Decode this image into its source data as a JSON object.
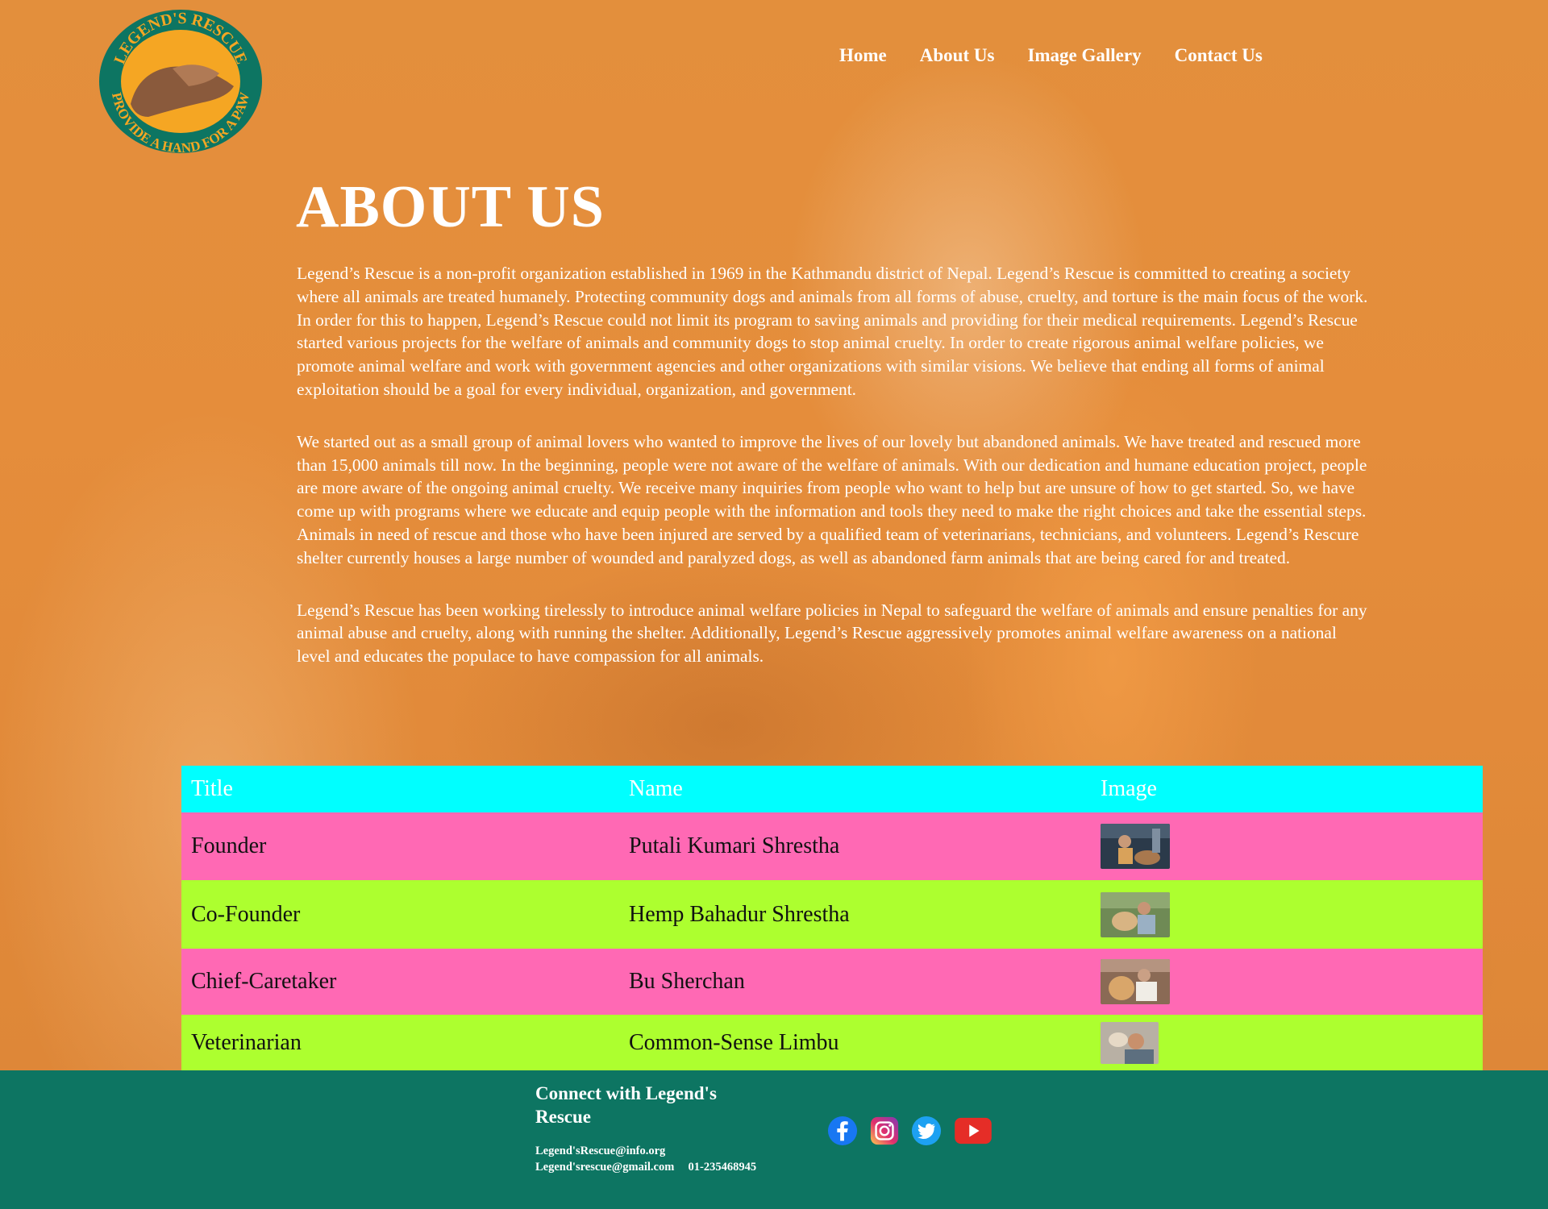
{
  "logo": {
    "top_text": "LEGEND'S RESCUE",
    "bottom_text": "PROVIDE A HAND FOR A PAW",
    "colors": {
      "ring": "#0d7562",
      "inner": "#f5a623",
      "text": "#f5a623"
    }
  },
  "nav": {
    "items": [
      {
        "label": "Home"
      },
      {
        "label": "About Us"
      },
      {
        "label": "Image Gallery"
      },
      {
        "label": "Contact Us"
      }
    ]
  },
  "page_title": "ABOUT US",
  "about_paragraphs": [
    "Legend’s Rescue is a non-profit organization established in 1969 in the Kathmandu district of Nepal. Legend’s Rescue is committed to creating a society where all animals are treated humanely. Protecting community dogs and animals from all forms of abuse, cruelty, and torture is the main focus of the work. In order for this to happen, Legend’s Rescue could not limit its program to saving animals and providing for their medical requirements. Legend’s Rescue started various projects for the welfare of animals and community dogs to stop animal cruelty. In order to create rigorous animal welfare policies, we promote animal welfare and work with government agencies and other organizations with similar visions. We believe that ending all forms of animal exploitation should be a goal for every individual, organization, and government.",
    "We started out as a small group of animal lovers who wanted to improve the lives of our lovely but abandoned animals. We have treated and rescued more than 15,000 animals till now. In the beginning, people were not aware of the welfare of animals. With our dedication and humane education project, people are more aware of the ongoing animal cruelty. We receive many inquiries from people who want to help but are unsure of how to get started. So, we have come up with programs where we educate and equip people with the information and tools they need to make the right choices and take the essential steps. Animals in need of rescue and those who have been injured are served by a qualified team of veterinarians, technicians, and volunteers. Legend’s Rescure shelter currently houses a large number of wounded and paralyzed dogs, as well as abandoned farm animals that are being cared for and treated.",
    "Legend’s Rescue has been working tirelessly to introduce animal welfare policies in Nepal to safeguard the welfare of animals and ensure penalties for any animal abuse and cruelty, along with running the shelter. Additionally, Legend’s Rescue aggressively promotes animal welfare awareness on a national level and educates the populace to have compassion for all animals."
  ],
  "staff_table": {
    "headers": [
      "Title",
      "Name",
      "Image"
    ],
    "rows": [
      {
        "title": "Founder",
        "name": "Putali Kumari Shrestha",
        "image": "person-with-dog-photo"
      },
      {
        "title": "Co-Founder",
        "name": "Hemp Bahadur Shrestha",
        "image": "man-hugging-dog-photo"
      },
      {
        "title": "Chief-Caretaker",
        "name": "Bu Sherchan",
        "image": "man-with-golden-retriever-photo"
      },
      {
        "title": "Veterinarian",
        "name": "Common-Sense Limbu",
        "image": "man-with-puppy-photo"
      }
    ],
    "colors": {
      "header": "#00ffff",
      "row_a": "#ff69b4",
      "row_b": "#adff2f"
    }
  },
  "footer": {
    "title": "Connect with Legend's Rescue",
    "email_1": "Legend'sRescue@info.org",
    "email_2": "Legend'srescue@gmail.com",
    "phone": "01-235468945",
    "social": [
      "facebook-icon",
      "instagram-icon",
      "twitter-icon",
      "youtube-icon"
    ],
    "background": "#0d7562"
  }
}
